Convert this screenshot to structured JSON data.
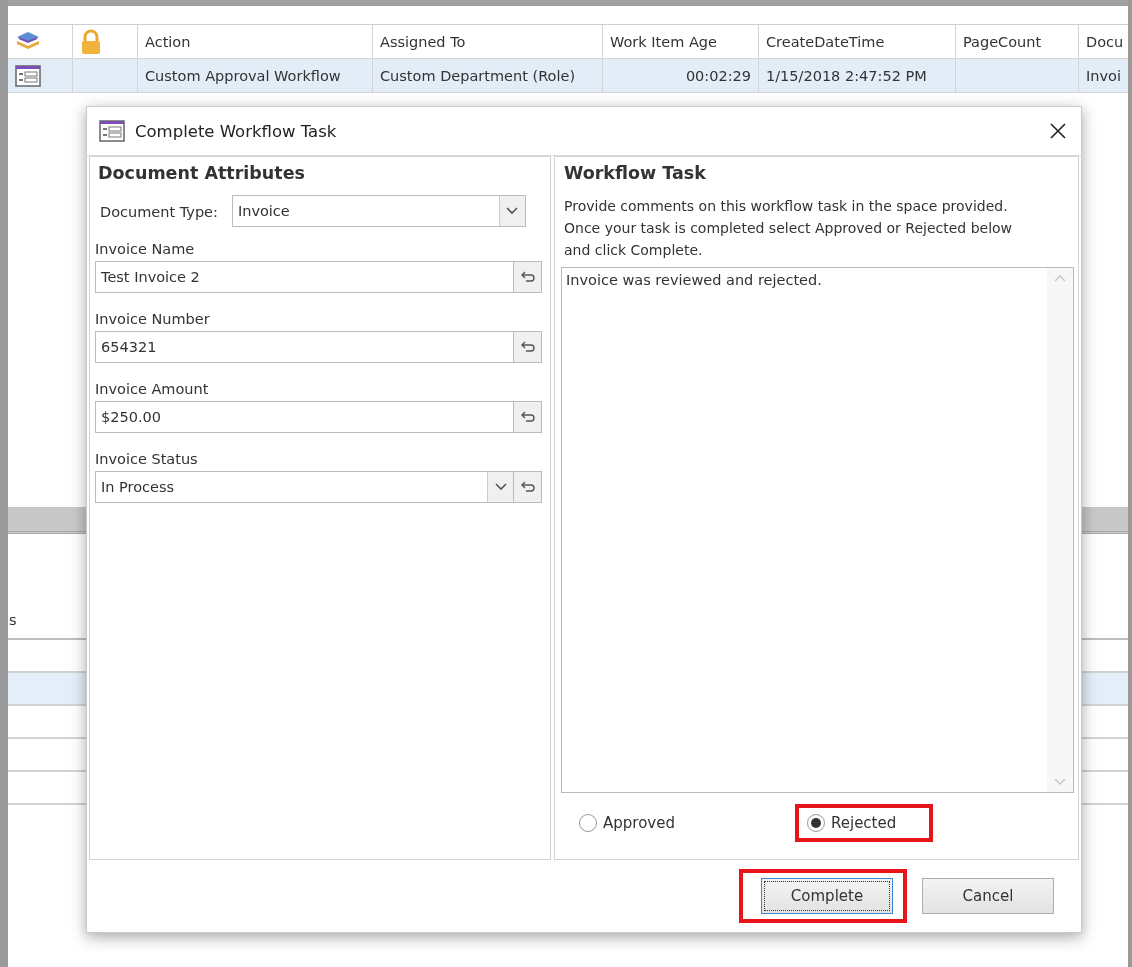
{
  "grid": {
    "columns": [
      {
        "kind": "stack"
      },
      {
        "kind": "lock"
      },
      {
        "kind": "text",
        "label": "Action"
      },
      {
        "kind": "text",
        "label": "Assigned To"
      },
      {
        "kind": "text",
        "label": "Work Item Age"
      },
      {
        "kind": "text",
        "label": "CreateDateTime"
      },
      {
        "kind": "text",
        "label": "PageCount"
      },
      {
        "kind": "text",
        "label": "Docu"
      }
    ],
    "rows": [
      {
        "selected": true,
        "cells": [
          {
            "kind": "form-icon"
          },
          {
            "kind": "blank"
          },
          {
            "kind": "text",
            "text": "Custom Approval Workflow"
          },
          {
            "kind": "text",
            "text": "Custom Department (Role)"
          },
          {
            "kind": "number",
            "text": "00:02:29"
          },
          {
            "kind": "text",
            "text": "1/15/2018 2:47:52 PM"
          },
          {
            "kind": "blank"
          },
          {
            "kind": "text",
            "text": "Invoi"
          }
        ]
      }
    ]
  },
  "lower_list": {
    "header_text": "s",
    "rows": [
      {
        "selected": false
      },
      {
        "selected": true
      },
      {
        "selected": false
      },
      {
        "selected": false
      },
      {
        "selected": false
      }
    ]
  },
  "dialog": {
    "title": "Complete Workflow Task",
    "left": {
      "heading": "Document Attributes",
      "document_type": {
        "label": "Document Type:",
        "value": "Invoice"
      },
      "fields": [
        {
          "label": "Invoice Name",
          "value": "Test Invoice 2",
          "kind": "text"
        },
        {
          "label": "Invoice Number",
          "value": "654321",
          "kind": "text"
        },
        {
          "label": "Invoice Amount",
          "value": "$250.00",
          "kind": "text"
        },
        {
          "label": "Invoice Status",
          "value": "In Process",
          "kind": "dropdown"
        }
      ]
    },
    "right": {
      "heading": "Workflow Task",
      "instructions": "Provide comments on this workflow task in the space provided.  Once your task is completed select Approved or Rejected below and click Complete.",
      "comments": "Invoice was reviewed and rejected.",
      "options": [
        {
          "label": "Approved",
          "selected": false,
          "highlighted": false
        },
        {
          "label": "Rejected",
          "selected": true,
          "highlighted": true
        }
      ]
    },
    "buttons": [
      {
        "label": "Complete",
        "default": true,
        "highlighted": true
      },
      {
        "label": "Cancel",
        "default": false,
        "highlighted": false
      }
    ]
  }
}
